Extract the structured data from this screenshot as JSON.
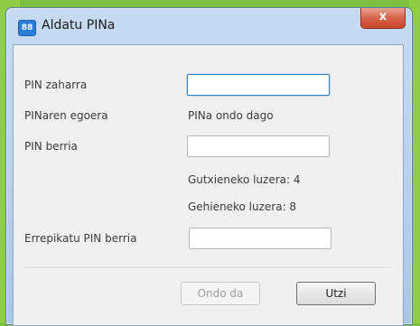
{
  "window": {
    "title": "Aldatu PINa",
    "icon": "app-logo-icon",
    "icon_glyph": "88",
    "close_glyph": "x"
  },
  "form": {
    "old_pin_label": "PIN zaharra",
    "old_pin_value": "",
    "status_label": "PINaren egoera",
    "status_value": "PINa ondo dago",
    "new_pin_label": "PIN berria",
    "new_pin_value": "",
    "min_length": "Gutxieneko luzera: 4",
    "max_length": "Gehieneko luzera: 8",
    "repeat_pin_label": "Errepikatu PIN berria",
    "repeat_pin_value": ""
  },
  "buttons": {
    "ok_label": "Ondo da",
    "cancel_label": "Utzi"
  },
  "colors": {
    "background": "#7fbf3f",
    "title_bar": "#b7d0ea",
    "close_button": "#d9624a",
    "focus_border": "#3c7fb1"
  }
}
